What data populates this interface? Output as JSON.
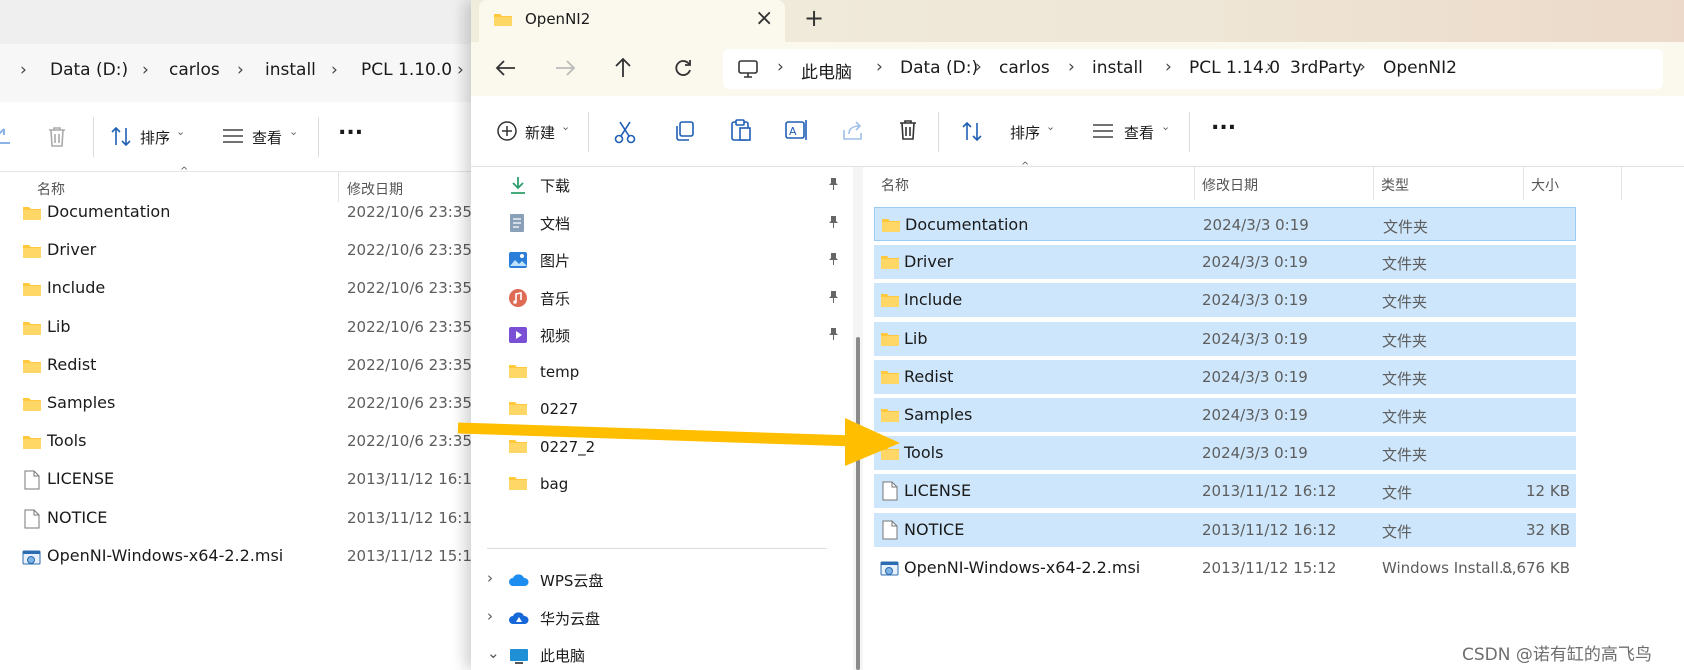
{
  "left_window": {
    "breadcrumbs": [
      "Data (D:)",
      "carlos",
      "install",
      "PCL 1.10.0"
    ],
    "toolbar": {
      "sort_label": "排序",
      "view_label": "查看",
      "more_label": "..."
    },
    "columns": {
      "name": "名称",
      "modified": "修改日期"
    },
    "files": [
      {
        "name": "Documentation",
        "modified": "2022/10/6 23:35",
        "kind": "folder"
      },
      {
        "name": "Driver",
        "modified": "2022/10/6 23:35",
        "kind": "folder"
      },
      {
        "name": "Include",
        "modified": "2022/10/6 23:35",
        "kind": "folder"
      },
      {
        "name": "Lib",
        "modified": "2022/10/6 23:35",
        "kind": "folder"
      },
      {
        "name": "Redist",
        "modified": "2022/10/6 23:35",
        "kind": "folder"
      },
      {
        "name": "Samples",
        "modified": "2022/10/6 23:35",
        "kind": "folder"
      },
      {
        "name": "Tools",
        "modified": "2022/10/6 23:35",
        "kind": "folder"
      },
      {
        "name": "LICENSE",
        "modified": "2013/11/12 16:12",
        "kind": "file"
      },
      {
        "name": "NOTICE",
        "modified": "2013/11/12 16:12",
        "kind": "file"
      },
      {
        "name": "OpenNI-Windows-x64-2.2.msi",
        "modified": "2013/11/12 15:12",
        "kind": "msi"
      }
    ]
  },
  "right_window": {
    "tab": {
      "title": "OpenNI2",
      "close": "×",
      "new_tab": "+"
    },
    "breadcrumbs": [
      "此电脑",
      "Data (D:)",
      "carlos",
      "install",
      "PCL 1.14.0",
      "3rdParty",
      "OpenNI2"
    ],
    "toolbar": {
      "new_label": "新建",
      "sort_label": "排序",
      "view_label": "查看",
      "more_label": "..."
    },
    "nav": {
      "quick_access": [
        {
          "label": "下载",
          "icon": "download-icon",
          "pinned": true
        },
        {
          "label": "文档",
          "icon": "document-icon",
          "pinned": true
        },
        {
          "label": "图片",
          "icon": "pictures-icon",
          "pinned": true
        },
        {
          "label": "音乐",
          "icon": "music-icon",
          "pinned": true
        },
        {
          "label": "视频",
          "icon": "video-icon",
          "pinned": true
        },
        {
          "label": "temp",
          "icon": "folder-icon",
          "pinned": false
        },
        {
          "label": "0227",
          "icon": "folder-icon",
          "pinned": false
        },
        {
          "label": "0227_2",
          "icon": "folder-icon",
          "pinned": false
        },
        {
          "label": "bag",
          "icon": "folder-icon",
          "pinned": false
        }
      ],
      "cloud": [
        {
          "label": "WPS云盘",
          "icon": "wps-cloud-icon"
        },
        {
          "label": "华为云盘",
          "icon": "huawei-cloud-icon"
        },
        {
          "label": "此电脑",
          "icon": "this-pc-icon"
        }
      ]
    },
    "columns": {
      "name": "名称",
      "modified": "修改日期",
      "type": "类型",
      "size": "大小"
    },
    "files": [
      {
        "name": "Documentation",
        "modified": "2024/3/3 0:19",
        "type": "文件夹",
        "size": "",
        "kind": "folder",
        "selected": true
      },
      {
        "name": "Driver",
        "modified": "2024/3/3 0:19",
        "type": "文件夹",
        "size": "",
        "kind": "folder",
        "selected": true
      },
      {
        "name": "Include",
        "modified": "2024/3/3 0:19",
        "type": "文件夹",
        "size": "",
        "kind": "folder",
        "selected": true
      },
      {
        "name": "Lib",
        "modified": "2024/3/3 0:19",
        "type": "文件夹",
        "size": "",
        "kind": "folder",
        "selected": true
      },
      {
        "name": "Redist",
        "modified": "2024/3/3 0:19",
        "type": "文件夹",
        "size": "",
        "kind": "folder",
        "selected": true
      },
      {
        "name": "Samples",
        "modified": "2024/3/3 0:19",
        "type": "文件夹",
        "size": "",
        "kind": "folder",
        "selected": true
      },
      {
        "name": "Tools",
        "modified": "2024/3/3 0:19",
        "type": "文件夹",
        "size": "",
        "kind": "folder",
        "selected": true
      },
      {
        "name": "LICENSE",
        "modified": "2013/11/12 16:12",
        "type": "文件",
        "size": "12 KB",
        "kind": "file",
        "selected": true
      },
      {
        "name": "NOTICE",
        "modified": "2013/11/12 16:12",
        "type": "文件",
        "size": "32 KB",
        "kind": "file",
        "selected": true
      },
      {
        "name": "OpenNI-Windows-x64-2.2.msi",
        "modified": "2013/11/12 15:12",
        "type": "Windows Install...",
        "size": "8,676 KB",
        "kind": "msi",
        "selected": false
      }
    ]
  },
  "annotation": {
    "arrow_color": "#ffbe00"
  },
  "watermark": "CSDN @诺有缸的高飞鸟",
  "colors": {
    "selection": "#cde6fb",
    "folder": "#ffc83d",
    "accent": "#0067c0"
  }
}
